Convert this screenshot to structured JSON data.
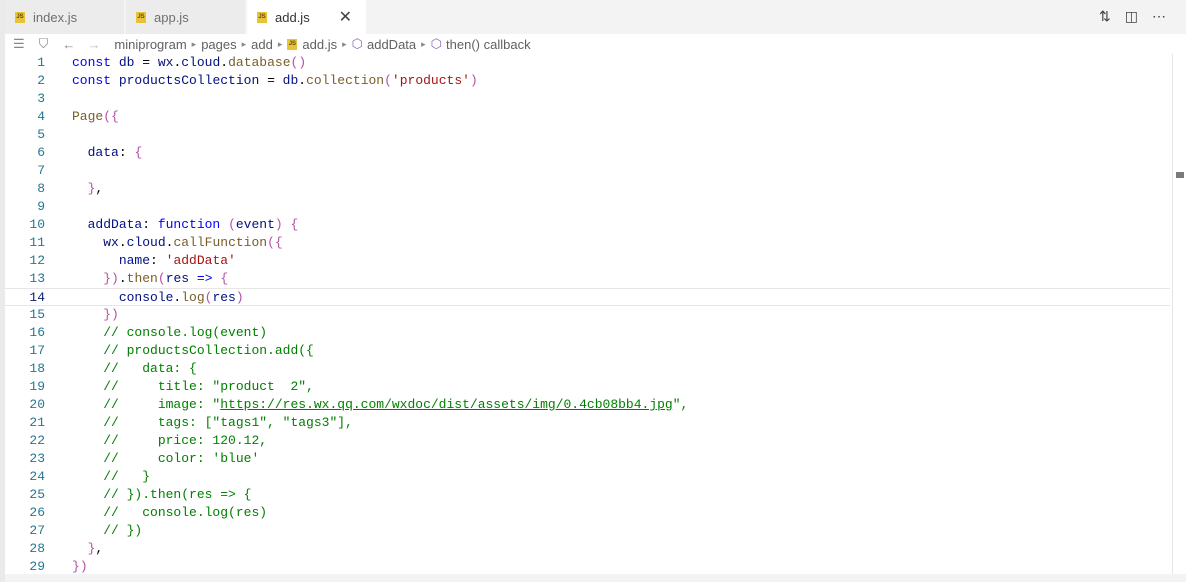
{
  "tabs": [
    {
      "label": "index.js",
      "active": false
    },
    {
      "label": "app.js",
      "active": false
    },
    {
      "label": "add.js",
      "active": true
    }
  ],
  "breadcrumb": [
    "miniprogram",
    "pages",
    "add",
    "add.js",
    "addData",
    "then() callback"
  ],
  "code_lines": [
    "const db = wx.cloud.database()",
    "const productsCollection = db.collection('products')",
    "",
    "Page({",
    "",
    "  data: {",
    "",
    "  },",
    "",
    "  addData: function (event) {",
    "    wx.cloud.callFunction({",
    "      name: 'addData'",
    "    }).then(res => {",
    "      console.log(res)",
    "    })",
    "    // console.log(event)",
    "    // productsCollection.add({",
    "    //   data: {",
    "    //     title: \"product  2\",",
    "    //     image: \"https://res.wx.qq.com/wxdoc/dist/assets/img/0.4cb08bb4.jpg\",",
    "    //     tags: [\"tags1\", \"tags3\"],",
    "    //     price: 120.12,",
    "    //     color: 'blue'",
    "    //   }",
    "    // }).then(res => {",
    "    //   console.log(res)",
    "    // })",
    "  },",
    "})"
  ],
  "current_line": 14
}
